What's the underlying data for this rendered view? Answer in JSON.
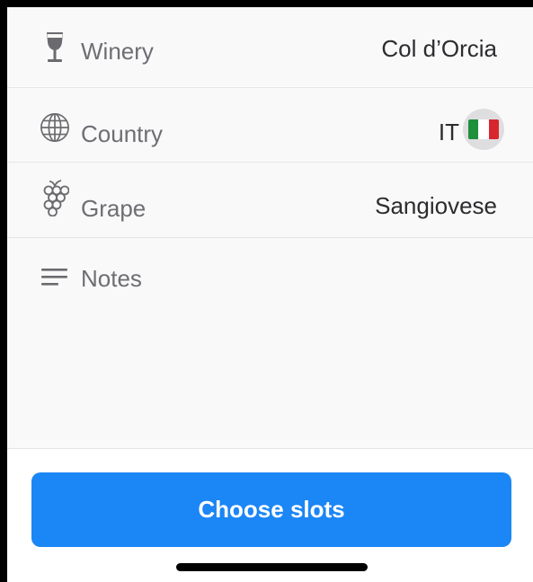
{
  "fields": {
    "winery": {
      "label": "Winery",
      "value": "Col d’Orcia",
      "icon": "wine-glass-icon"
    },
    "country": {
      "label": "Country",
      "value": "IT",
      "icon": "globe-icon",
      "flag": "italy-flag-icon",
      "flag_colors": [
        "#1f8f3a",
        "#ffffff",
        "#d7262e"
      ]
    },
    "grape": {
      "label": "Grape",
      "value": "Sangiovese",
      "icon": "grape-icon"
    },
    "notes": {
      "label": "Notes",
      "value": "",
      "icon": "text-lines-icon"
    }
  },
  "actions": {
    "choose_slots_label": "Choose slots"
  },
  "colors": {
    "accent": "#1b86f5",
    "label": "#6e6e73",
    "value": "#2c2c2e",
    "form_bg": "#f9f9fa"
  }
}
